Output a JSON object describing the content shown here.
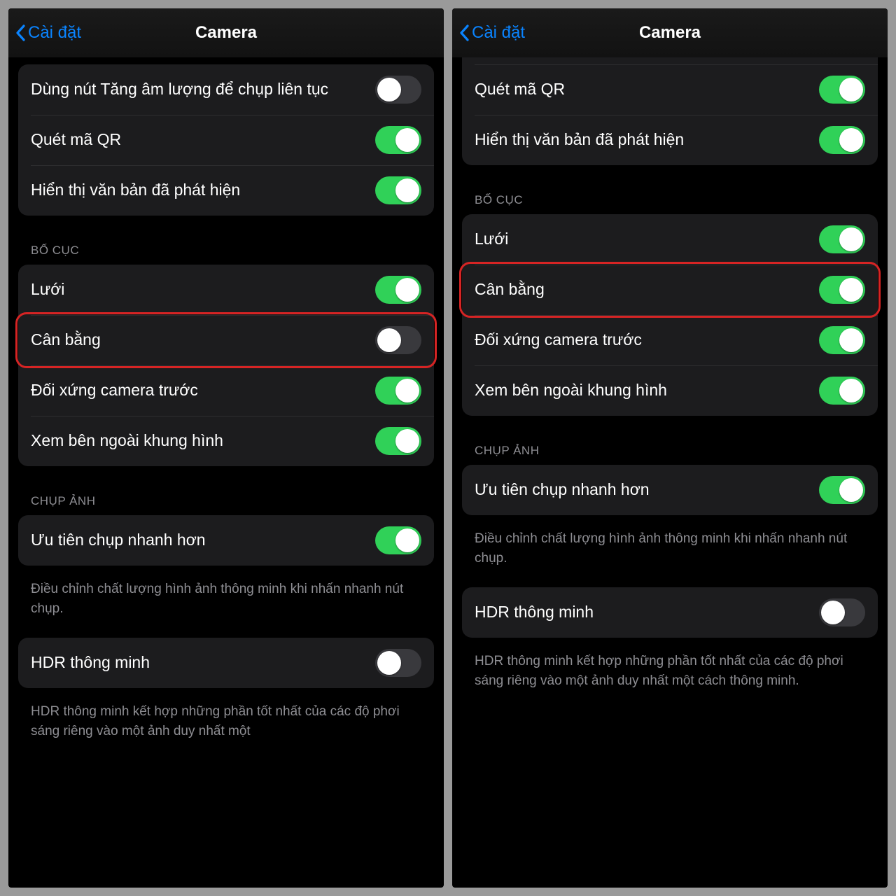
{
  "nav": {
    "back": "Cài đặt",
    "title": "Camera"
  },
  "sections": {
    "top": {
      "burst": "Dùng nút Tăng âm lượng để chụp liên tục",
      "qr": "Quét mã QR",
      "text_detect": "Hiển thị văn bản đã phát hiện"
    },
    "layout_header": "BỐ CỤC",
    "layout": {
      "grid": "Lưới",
      "level": "Cân bằng",
      "mirror": "Đối xứng camera trước",
      "outside": "Xem bên ngoài khung hình"
    },
    "capture_header": "CHỤP ẢNH",
    "capture": {
      "faster": "Ưu tiên chụp nhanh hơn",
      "faster_footer": "Điều chỉnh chất lượng hình ảnh thông minh khi nhấn nhanh nút chụp."
    },
    "hdr": {
      "smart": "HDR thông minh",
      "smart_footer_full": "HDR thông minh kết hợp những phần tốt nhất của các độ phơi sáng riêng vào một ảnh duy nhất một cách thông minh.",
      "smart_footer_cut": "HDR thông minh kết hợp những phần tốt nhất của các độ phơi sáng riêng vào một ảnh duy nhất một"
    }
  },
  "left": {
    "toggles": {
      "burst": false,
      "qr": true,
      "text_detect": true,
      "grid": true,
      "level": false,
      "mirror": true,
      "outside": true,
      "faster": true,
      "smart": false
    }
  },
  "right": {
    "toggles": {
      "burst": false,
      "qr": true,
      "text_detect": true,
      "grid": true,
      "level": true,
      "mirror": true,
      "outside": true,
      "faster": true,
      "smart": false
    }
  }
}
